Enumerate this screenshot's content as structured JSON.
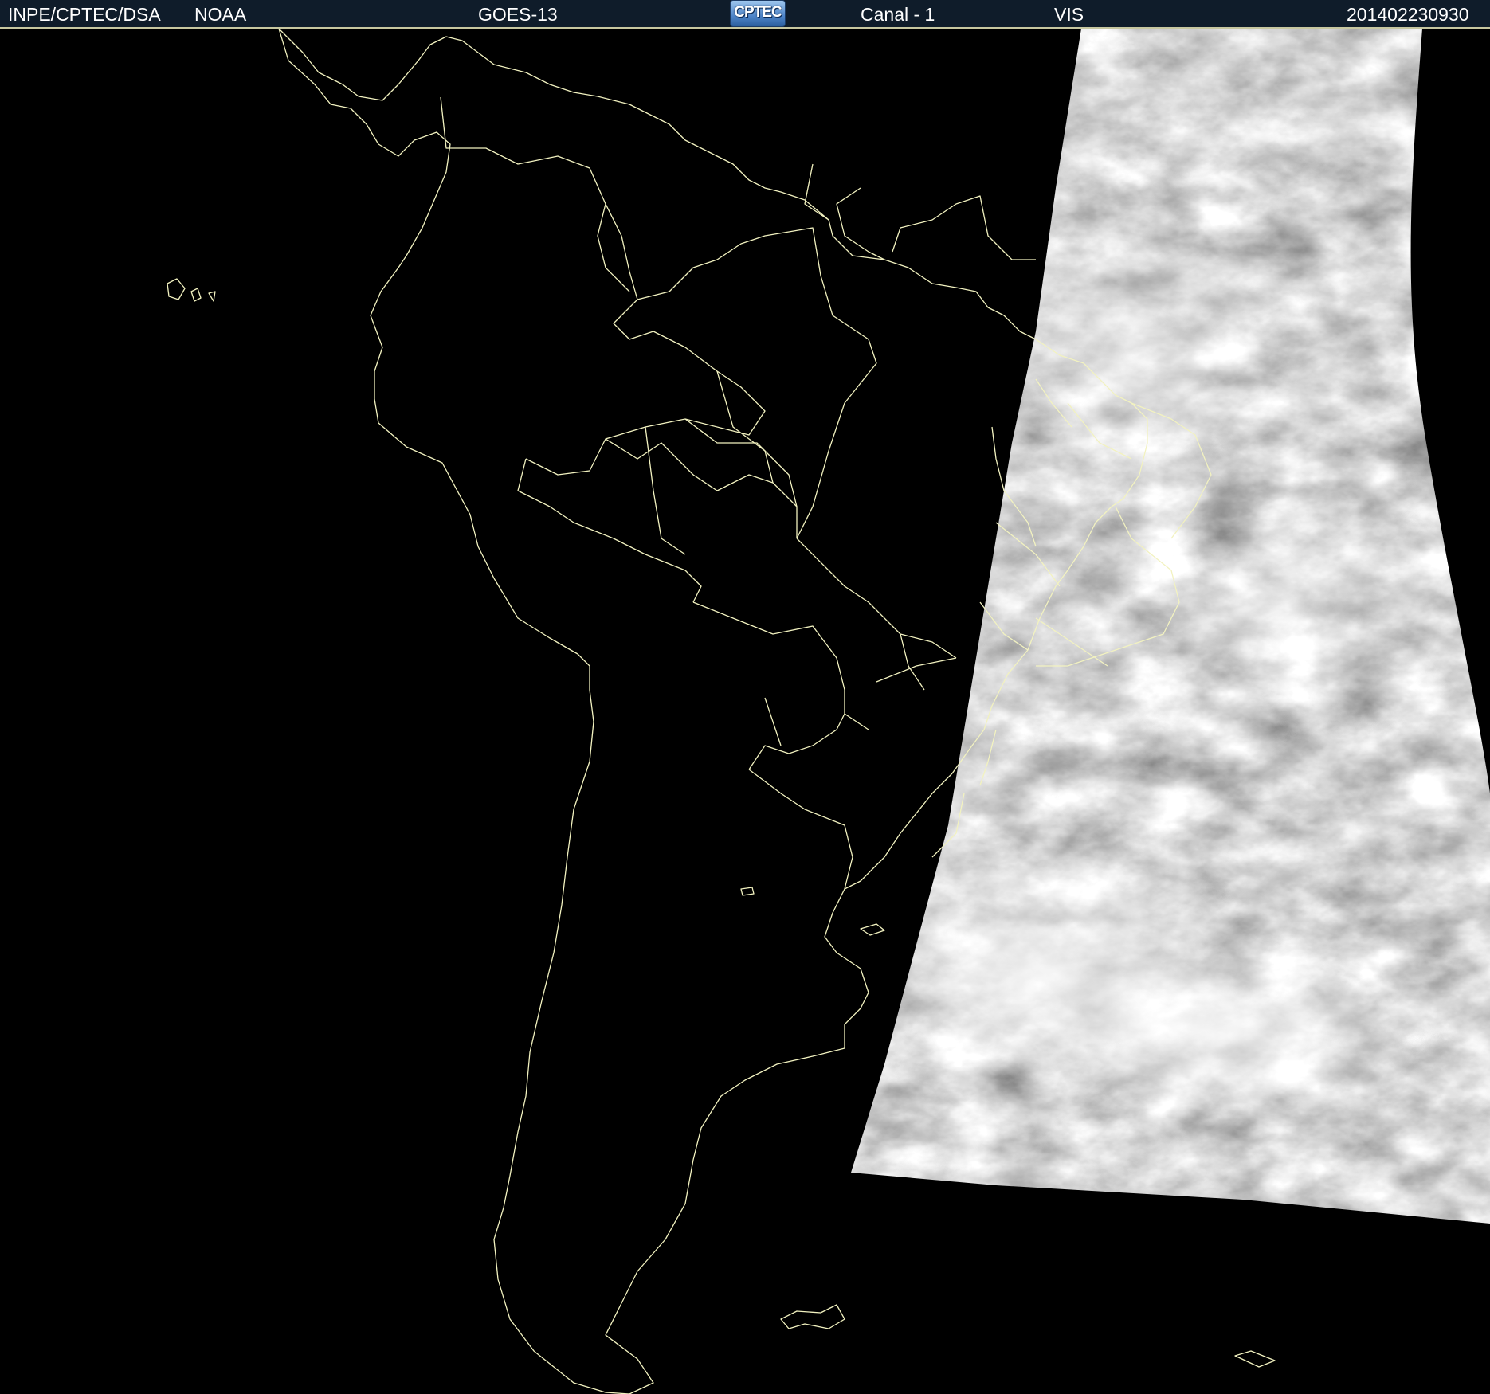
{
  "header": {
    "institution": "INPE/CPTEC/DSA",
    "agency": "NOAA",
    "satellite": "GOES-13",
    "logo_text": "CPTEC",
    "channel": "Canal - 1",
    "band": "VIS",
    "timestamp": "201402230930"
  },
  "colors": {
    "header_bg": "#0f1c2a",
    "header_text": "#ffffff",
    "boundary_lines": "#f2f2c0",
    "space_bg": "#000000"
  },
  "map": {
    "region": "South America",
    "imagery": "visible channel cloud cover, partial disk swath"
  }
}
